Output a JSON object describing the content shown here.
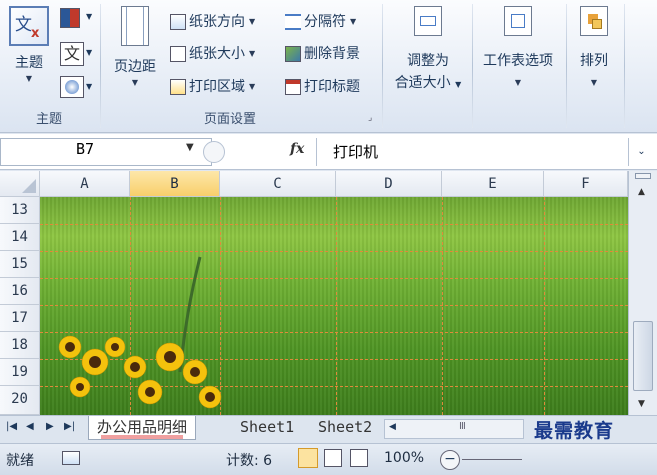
{
  "ribbon": {
    "themes_group": {
      "label": "主题",
      "themes_button": "主题"
    },
    "page_setup_group": {
      "label": "页面设置",
      "margins_button": "页边距",
      "orientation_button": "纸张方向",
      "size_button": "纸张大小",
      "print_area_button": "打印区域",
      "breaks_button": "分隔符",
      "background_button": "删除背景",
      "print_titles_button": "打印标题"
    },
    "scale_button": {
      "line1": "调整为",
      "line2": "合适大小"
    },
    "sheet_options_button": "工作表选项",
    "arrange_button": "排列"
  },
  "formula_bar": {
    "name_box": "B7",
    "fx_label": "fx",
    "formula_value": "打印机"
  },
  "grid": {
    "columns": [
      "A",
      "B",
      "C",
      "D",
      "E",
      "F"
    ],
    "selected_column": "B",
    "rows": [
      "13",
      "14",
      "15",
      "16",
      "17",
      "18",
      "19",
      "20"
    ]
  },
  "sheet_tabs": {
    "active": "办公用品明细",
    "tabs": [
      "Sheet1",
      "Sheet2"
    ]
  },
  "status_bar": {
    "mode": "就绪",
    "count": "计数: 6",
    "zoom": "100%"
  },
  "watermark": "最需教育",
  "colors": {
    "accent": "#f8cf6b",
    "page_break": "#e08a3a",
    "grass": "#6fb133"
  }
}
